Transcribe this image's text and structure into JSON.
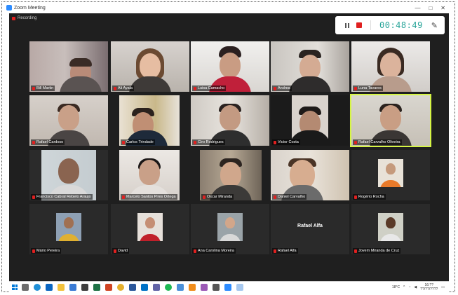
{
  "window": {
    "title": "Zoom Meeting",
    "minimize": "—",
    "maximize": "□",
    "close": "✕"
  },
  "recording": {
    "label": "Recording",
    "timer": "00:48:49"
  },
  "colors": {
    "mic_muted": "#e02020",
    "active_speaker": "#d6f545",
    "timer": "#2aa59a",
    "meeting_bg": "#1f1f1f"
  },
  "participants": [
    {
      "name": "Bill Martin",
      "muted": true
    },
    {
      "name": "Ali Ayala",
      "muted": true
    },
    {
      "name": "Luisa Camacho",
      "muted": true
    },
    {
      "name": "Andrea",
      "muted": true
    },
    {
      "name": "Luna Tavares",
      "muted": true
    },
    {
      "name": "Rafael Cardoso",
      "muted": true
    },
    {
      "name": "Carlos Trindade",
      "muted": true
    },
    {
      "name": "Ciro Rodrigues",
      "muted": true
    },
    {
      "name": "Victor Costa",
      "muted": true
    },
    {
      "name": "Rafael Carvalho Oliveira",
      "muted": true
    },
    {
      "name": "Francisco Cabral Rebelo Araujo",
      "muted": true
    },
    {
      "name": "Marcelo Santos Pires Ortega",
      "muted": true
    },
    {
      "name": "Oscar Miranda",
      "muted": true
    },
    {
      "name": "Daniel Carvalho",
      "muted": true
    },
    {
      "name": "Rogério Rocha",
      "muted": true
    },
    {
      "name": "Mário Pereira",
      "muted": true
    },
    {
      "name": "David",
      "muted": true
    },
    {
      "name": "Ana Carolina Moreira",
      "muted": true
    },
    {
      "name": "Rafael Alfa",
      "muted": true
    },
    {
      "name": "Jovem Miranda de Cruz",
      "muted": true
    }
  ],
  "video_off_label": "Rafael Alfa",
  "taskbar": {
    "time": "16:??",
    "date": "??/??/????",
    "weather": "18°C"
  }
}
